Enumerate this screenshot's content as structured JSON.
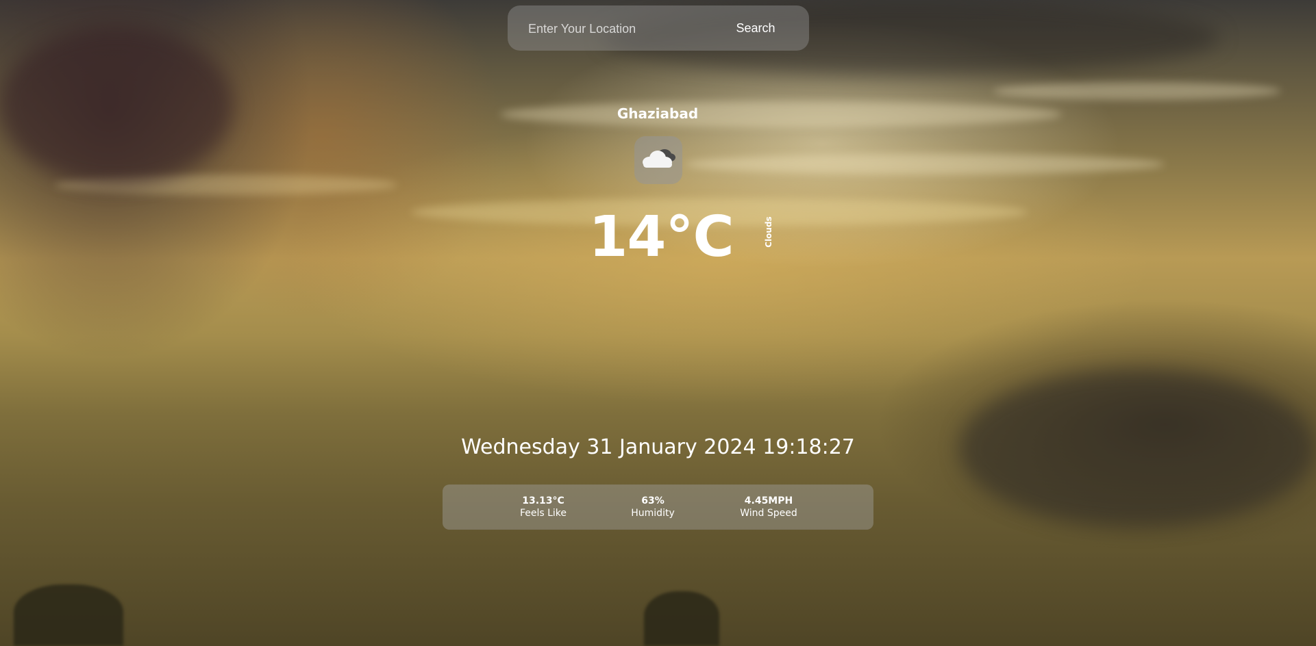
{
  "search": {
    "placeholder": "Enter Your Location",
    "button_label": "Search"
  },
  "weather": {
    "city": "Ghaziabad",
    "icon": "cloud-icon",
    "temperature": "14°C",
    "condition": "Clouds",
    "datetime": "Wednesday 31 January 2024 19:18:27"
  },
  "stats": [
    {
      "value": "13.13°C",
      "label": "Feels Like"
    },
    {
      "value": "63%",
      "label": "Humidity"
    },
    {
      "value": "4.45MPH",
      "label": "Wind Speed"
    }
  ]
}
